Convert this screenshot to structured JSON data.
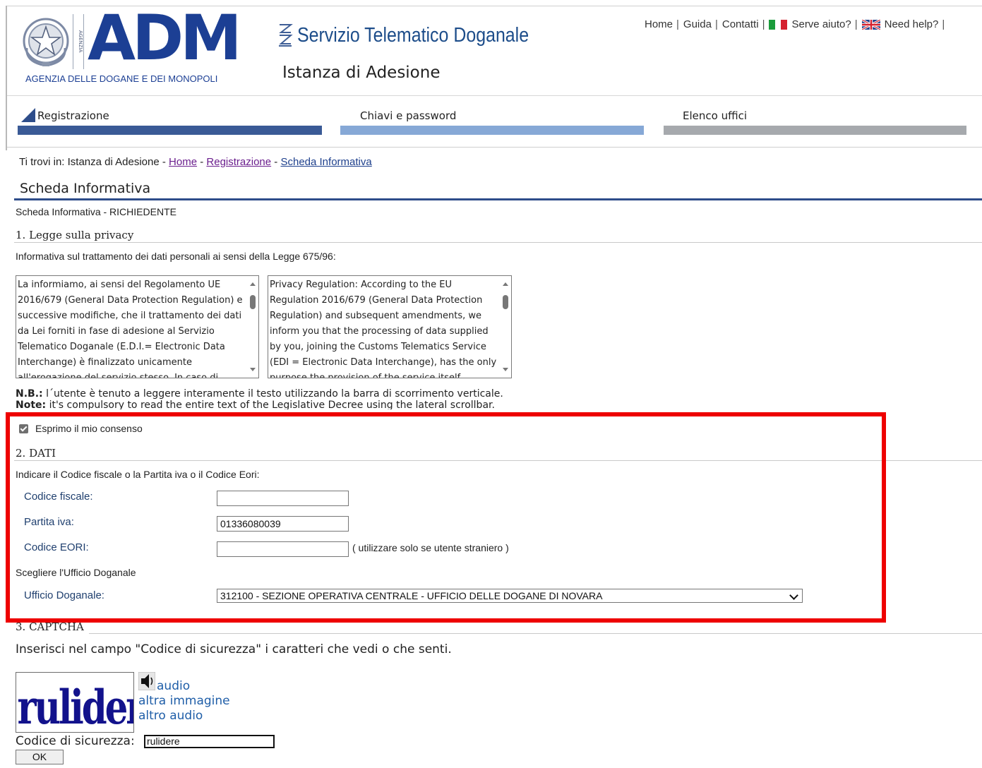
{
  "logo": {
    "brand": "ADM",
    "agency_name": "AGENZIA DELLE DOGANE E DEI MONOPOLI",
    "vertical_text": "AGENZIA",
    "emblem": "italian-republic-emblem-icon"
  },
  "service": {
    "title": "Servizio Telematico Doganale",
    "subtitle": "Istanza di Adesione"
  },
  "topnav": {
    "home": "Home",
    "guide": "Guida",
    "contacts": "Contatti",
    "help_it": "Serve aiuto?",
    "help_en": "Need help?"
  },
  "steps": [
    {
      "label": "Registrazione",
      "color": "#3a5a96"
    },
    {
      "label": "Chiavi e password",
      "color": "#86a8d6"
    },
    {
      "label": "Elenco uffici",
      "color": "#a6a9ad"
    }
  ],
  "breadcrumb": {
    "prefix": "Ti trovi in: Istanza di Adesione - ",
    "home": "Home",
    "registration": "Registrazione",
    "current": "Scheda Informativa"
  },
  "page": {
    "title": "Scheda Informativa",
    "subtitle": "Scheda Informativa - RICHIEDENTE"
  },
  "privacy": {
    "heading": "1. Legge sulla privacy",
    "intro": "Informativa sul trattamento dei dati personali ai sensi della Legge 675/96:",
    "text_it": "La informiamo, ai sensi del Regolamento UE 2016/679 (General Data Protection Regulation) e successive modifiche, che il trattamento dei dati da Lei forniti in fase di adesione al Servizio Telematico Doganale (E.D.I.= Electronic Data Interchange) è finalizzato unicamente all'erogazione del servizio stesso. In caso di",
    "text_en": "Privacy Regulation: According to the EU Regulation 2016/679 (General Data Protection Regulation) and subsequent amendments, we inform you that the processing of data supplied by you, joining the Customs Telematics Service (EDI = Electronic Data Interchange), has the only purpose the provision of the service itself.",
    "note_it_label": "N.B.:",
    "note_it": " l´utente è tenuto a leggere interamente il testo utilizzando la barra di scorrimento verticale.",
    "note_en_label": "Note:",
    "note_en": " it's compulsory to read the entire text of the Legislative Decree using the lateral scrollbar.",
    "consent_label": "Esprimo il mio consenso",
    "consent_checked": true
  },
  "dati": {
    "heading": "2. DATI",
    "instruction": "Indicare il Codice fiscale o la Partita iva o il Codice Eori:",
    "codice_fiscale_label": "Codice fiscale:",
    "codice_fiscale_value": "",
    "partita_iva_label": "Partita iva:",
    "partita_iva_value": "01336080039",
    "eori_label": "Codice EORI:",
    "eori_value": "",
    "eori_hint": "( utilizzare solo se utente straniero )",
    "office_section": "Scegliere l'Ufficio Doganale",
    "office_label": "Ufficio Doganale:",
    "office_value": "312100 - SEZIONE OPERATIVA CENTRALE - UFFICIO DELLE DOGANE DI NOVARA"
  },
  "captcha": {
    "heading": "3. CAPTCHA",
    "intro": "Inserisci nel campo \"Codice di sicurezza\" i caratteri che vedi o che senti.",
    "image_text": "rulidere",
    "audio": "audio",
    "other_image": "altra immagine",
    "other_audio": "altro audio",
    "code_label": "Codice di sicurezza:",
    "code_value": "rulidere",
    "ok": "OK"
  },
  "highlight_color": "#ee0000",
  "accent_color": "#2e4d8a"
}
